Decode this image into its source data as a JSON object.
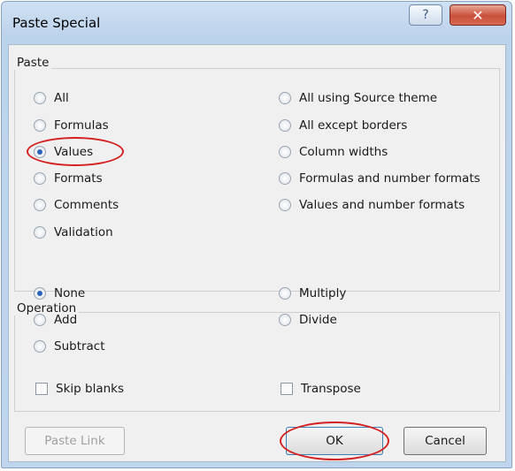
{
  "window": {
    "title": "Paste Special",
    "help_glyph": "?",
    "close_glyph": "✕"
  },
  "paste": {
    "label": "Paste",
    "left_options": [
      "All",
      "Formulas",
      "Values",
      "Formats",
      "Comments",
      "Validation"
    ],
    "right_options": [
      "All using Source theme",
      "All except borders",
      "Column widths",
      "Formulas and number formats",
      "Values and number formats"
    ],
    "selected": "Values"
  },
  "operation": {
    "label": "Operation",
    "left_options": [
      "None",
      "Add",
      "Subtract"
    ],
    "right_options": [
      "Multiply",
      "Divide"
    ],
    "selected": "None"
  },
  "checkboxes": {
    "skip_blanks": "Skip blanks",
    "transpose": "Transpose"
  },
  "buttons": {
    "paste_link": "Paste Link",
    "ok": "OK",
    "cancel": "Cancel"
  },
  "colors": {
    "highlight": "#d42020",
    "radio_dot": "#2a62b8"
  }
}
